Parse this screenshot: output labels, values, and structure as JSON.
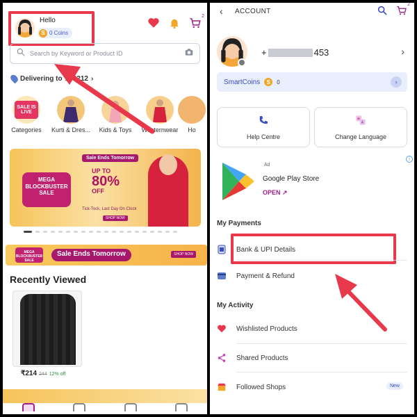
{
  "left": {
    "greeting": "Hello",
    "coins": "0 Coins",
    "coin_symbol": "S",
    "cart_count": "2",
    "search_placeholder": "Search by Keyword or Product ID",
    "deliver_prefix": "Delivering to",
    "deliver_pin": "173212",
    "categories": [
      {
        "label": "Categories",
        "badge": "SALE IS LIVE"
      },
      {
        "label": "Kurti & Dres..."
      },
      {
        "label": "Kids & Toys"
      },
      {
        "label": "Westernwear"
      },
      {
        "label": "Ho"
      }
    ],
    "banner": {
      "ends": "Sale Ends Tomorrow",
      "mega": "MEGA BLOCKBUSTER SALE",
      "upto": "UP TO",
      "off": "80%",
      "off_word": "OFF",
      "tick": "Tick-Tock, Last Day On Clock",
      "shop": "SHOP NOW"
    },
    "strip": {
      "text": "Sale Ends Tomorrow",
      "mini": "MEGA BLOCKBUSTER SALE",
      "shop": "SHOP NOW"
    },
    "recently_viewed_title": "Recently Viewed",
    "product": {
      "price": "₹214",
      "mrp": "244",
      "discount": "12% off"
    }
  },
  "right": {
    "header_title": "ACCOUNT",
    "cart_count": "2",
    "phone_prefix": "+",
    "phone_suffix": "453",
    "smartcoins_label": "SmartCoins",
    "smartcoins_symbol": "S",
    "smartcoins_value": "0",
    "tiles": [
      "Help Centre",
      "Change Language"
    ],
    "ad": {
      "tag": "Ad",
      "name": "Google Play Store",
      "action": "OPEN"
    },
    "payments_header": "My Payments",
    "payments": [
      "Bank & UPI Details",
      "Payment & Refund"
    ],
    "activity_header": "My Activity",
    "activity": [
      "Wishlisted Products",
      "Shared Products",
      "Followed Shops"
    ],
    "new_badge": "New"
  },
  "colors": {
    "accent": "#9f2089",
    "highlight": "#e8394c",
    "arrow": "#e8394c",
    "link": "#3b4cc0"
  }
}
